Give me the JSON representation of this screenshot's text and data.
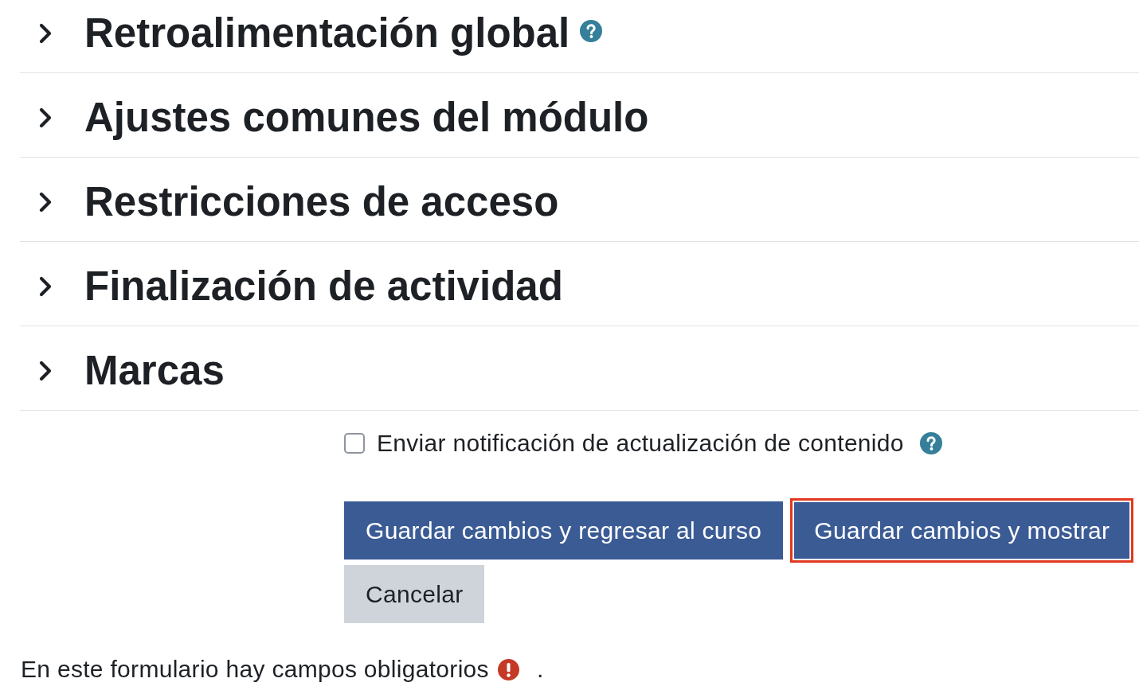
{
  "sections": [
    {
      "title": "Retroalimentación global",
      "expanded": false,
      "help": true
    },
    {
      "title": "Ajustes comunes del módulo",
      "expanded": false,
      "help": false
    },
    {
      "title": "Restricciones de acceso",
      "expanded": false,
      "help": false
    },
    {
      "title": "Finalización de actividad",
      "expanded": false,
      "help": false
    },
    {
      "title": "Marcas",
      "expanded": false,
      "help": false
    }
  ],
  "notification_option": {
    "label": "Enviar notificación de actualización de contenido",
    "checked": false,
    "help": true
  },
  "buttons": [
    {
      "label": "Guardar cambios y regresar al curso",
      "kind": "primary",
      "highlighted": false
    },
    {
      "label": "Guardar cambios y mostrar",
      "kind": "primary",
      "highlighted": true
    },
    {
      "label": "Cancelar",
      "kind": "secondary",
      "highlighted": false
    }
  ],
  "required_notice": {
    "text": "En este formulario hay campos obligatorios",
    "suffix": "."
  }
}
